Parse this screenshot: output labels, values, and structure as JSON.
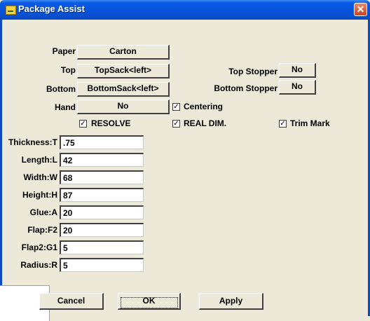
{
  "window": {
    "title": "Package Assist",
    "close_glyph": "✕",
    "icon": "package-icon"
  },
  "paper": {
    "label": "Paper",
    "value": "Carton"
  },
  "top": {
    "label": "Top",
    "value": "TopSack<left>"
  },
  "bottom": {
    "label": "Bottom",
    "value": "BottomSack<left>"
  },
  "hand": {
    "label": "Hand",
    "value": "No"
  },
  "top_stopper": {
    "label": "Top Stopper",
    "value": "No"
  },
  "bottom_stopper": {
    "label": "Bottom Stopper",
    "value": "No"
  },
  "checks": {
    "centering": {
      "label": "Centering",
      "checked": true
    },
    "resolve": {
      "label": "RESOLVE",
      "checked": true
    },
    "real_dim": {
      "label": "REAL DIM.",
      "checked": true
    },
    "trim_mark": {
      "label": "Trim Mark",
      "checked": true
    }
  },
  "check_glyph": "✓",
  "fields": [
    {
      "label": "Thickness:T",
      "value": ".75"
    },
    {
      "label": "Length:L",
      "value": "42"
    },
    {
      "label": "Width:W",
      "value": "68"
    },
    {
      "label": "Height:H",
      "value": "87"
    },
    {
      "label": "Glue:A",
      "value": "20"
    },
    {
      "label": "Flap:F2",
      "value": "20"
    },
    {
      "label": "Flap2:G1",
      "value": "5"
    },
    {
      "label": "Radius:R",
      "value": "5"
    }
  ],
  "buttons": {
    "cancel": "Cancel",
    "ok": "OK",
    "apply": "Apply"
  }
}
